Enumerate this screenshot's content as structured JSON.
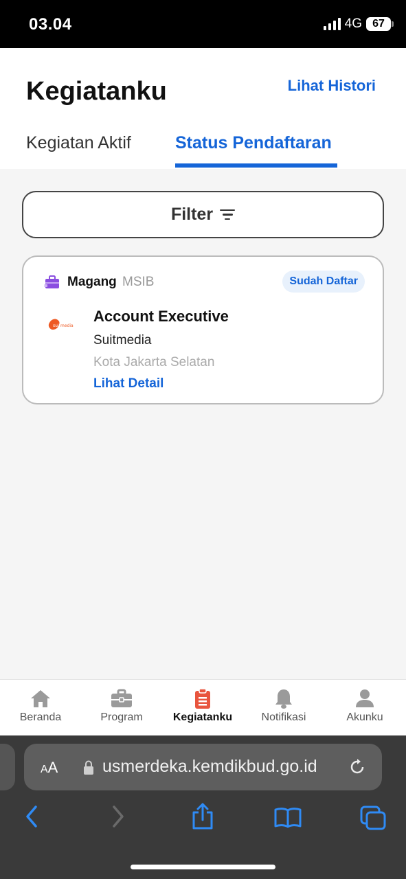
{
  "status_bar": {
    "time": "03.04",
    "network": "4G",
    "battery": "67"
  },
  "header": {
    "title": "Kegiatanku",
    "history_link": "Lihat Histori"
  },
  "tabs": [
    {
      "label": "Kegiatan Aktif",
      "active": false
    },
    {
      "label": "Status Pendaftaran",
      "active": true
    }
  ],
  "filter": {
    "label": "Filter",
    "icon": "filter-lines-icon"
  },
  "activity_card": {
    "category": "Magang",
    "category_sub": "MSIB",
    "category_icon": "briefcase-icon",
    "status": "Sudah Daftar",
    "job_title": "Account Executive",
    "company": "Suitmedia",
    "company_logo_text": "suitmedia",
    "location": "Kota Jakarta Selatan",
    "detail_link": "Lihat Detail"
  },
  "bottom_nav": [
    {
      "label": "Beranda",
      "icon": "home-icon",
      "active": false
    },
    {
      "label": "Program",
      "icon": "briefcase-icon",
      "active": false
    },
    {
      "label": "Kegiatanku",
      "icon": "clipboard-icon",
      "active": true
    },
    {
      "label": "Notifikasi",
      "icon": "bell-icon",
      "active": false
    },
    {
      "label": "Akunku",
      "icon": "user-icon",
      "active": false
    }
  ],
  "browser": {
    "text_size_label_small": "A",
    "text_size_label_large": "A",
    "url": "usmerdeka.kemdikbud.go.id"
  },
  "colors": {
    "accent": "#1565d8",
    "active_nav": "#e8553e",
    "category_purple": "#8a4ee0"
  }
}
